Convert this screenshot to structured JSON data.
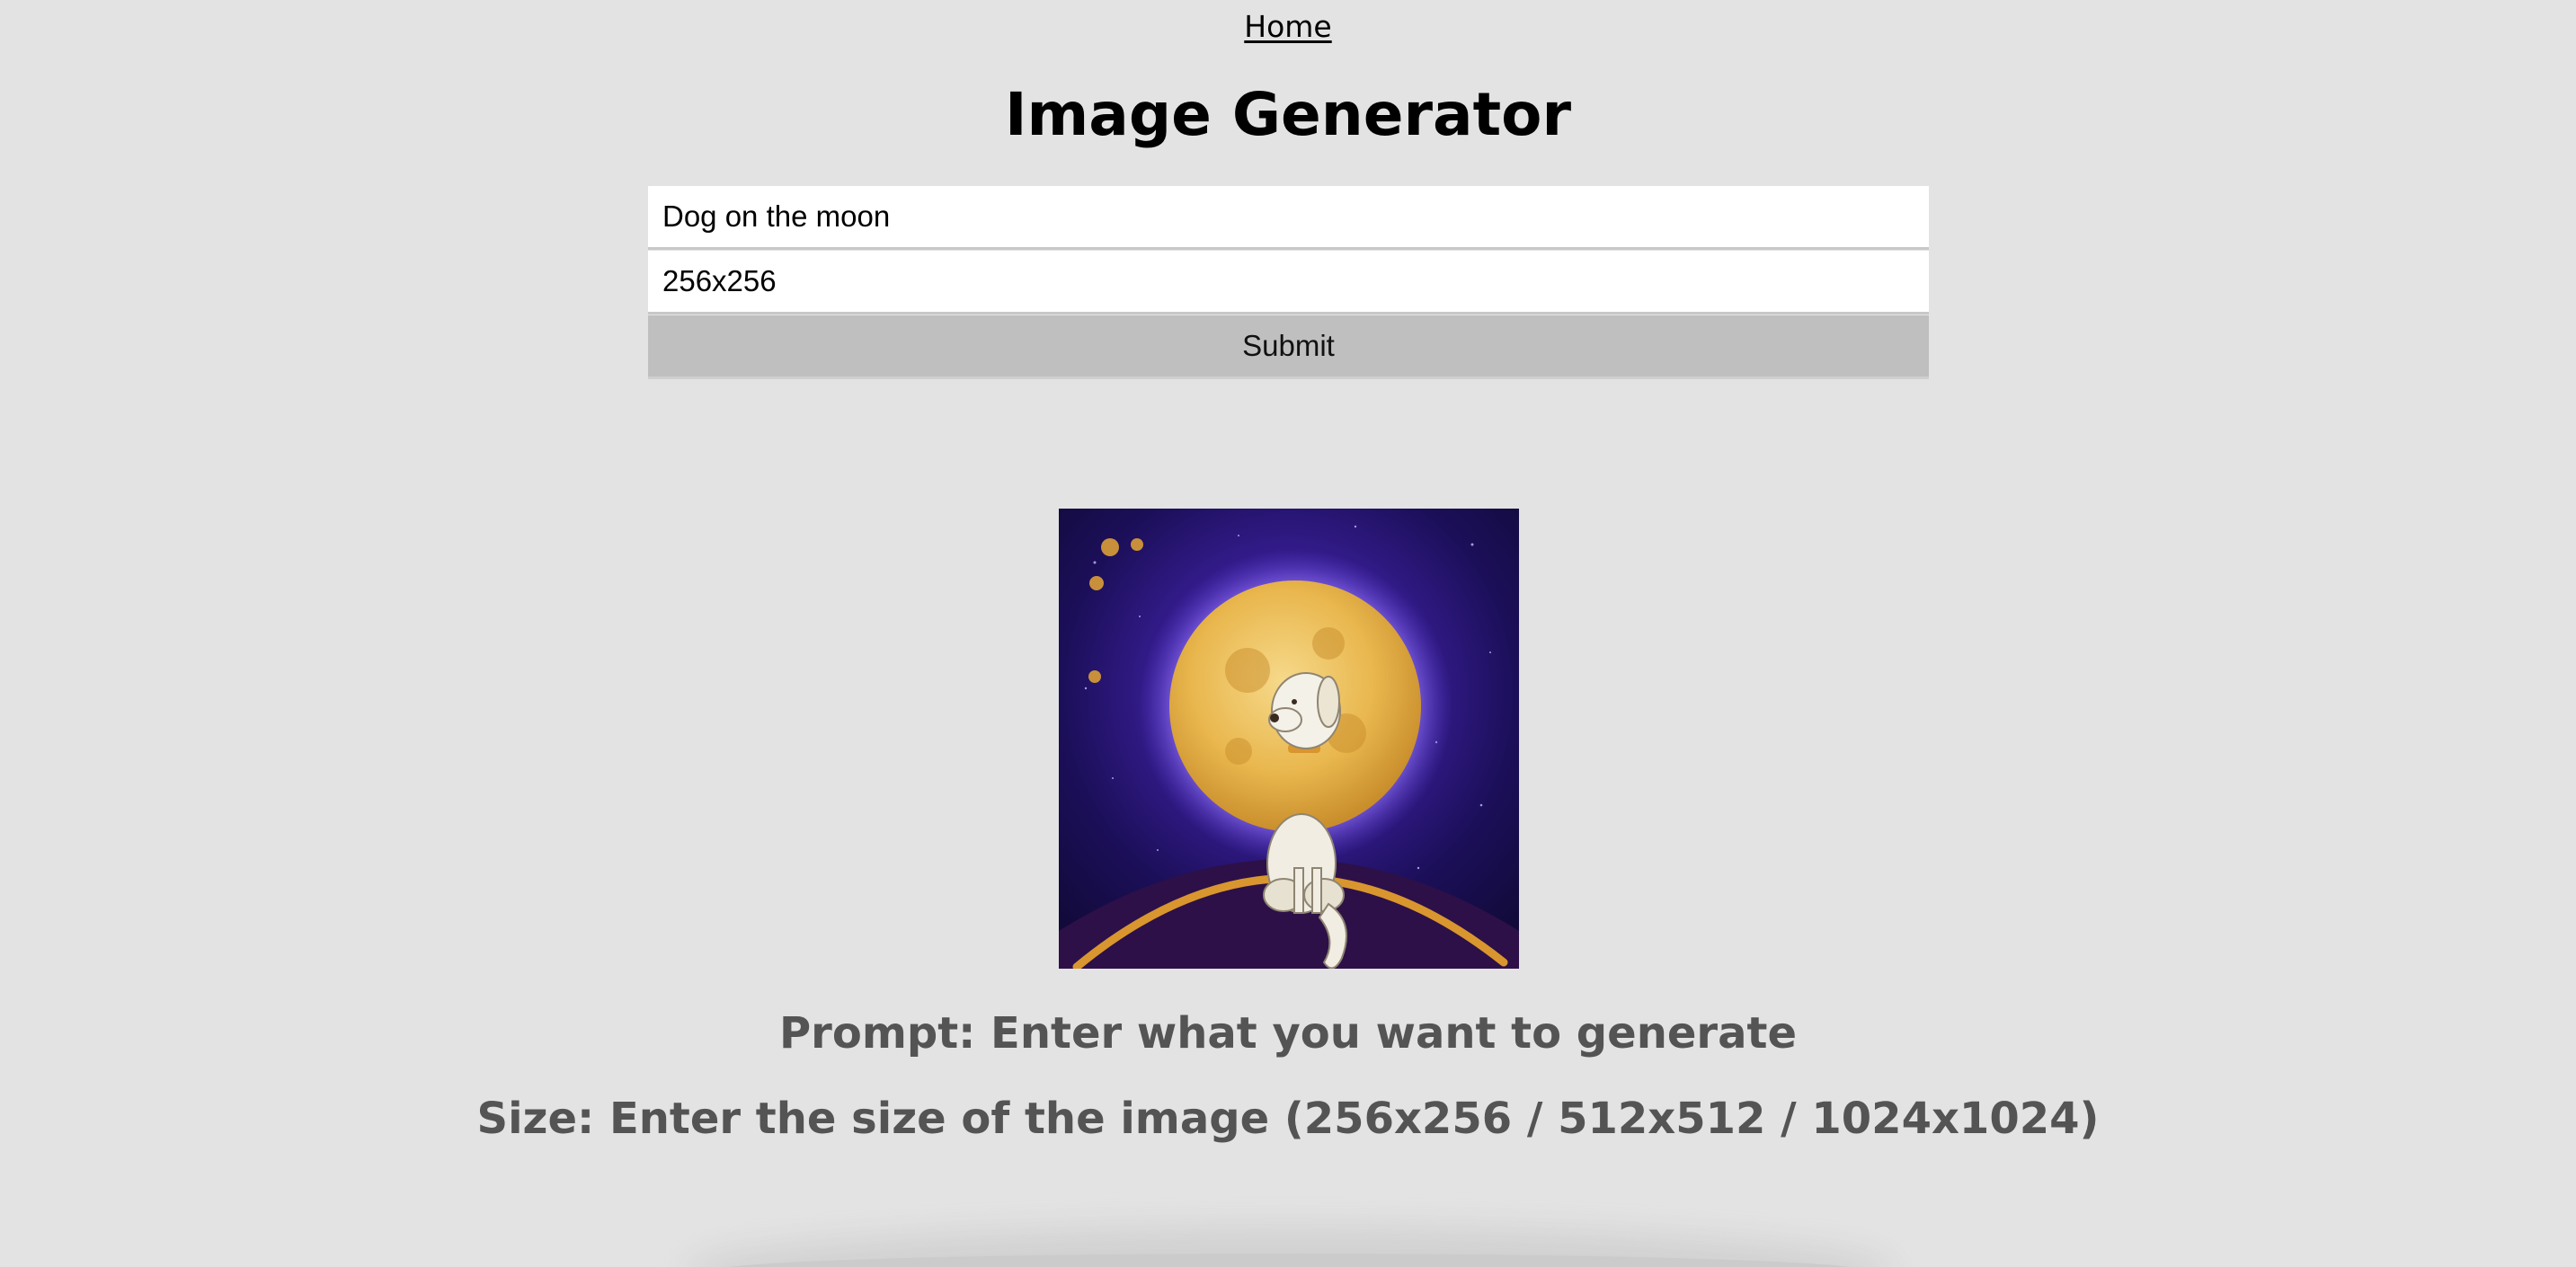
{
  "nav": {
    "home_label": "Home"
  },
  "header": {
    "title": "Image Generator"
  },
  "form": {
    "prompt_value": "Dog on the moon",
    "size_value": "256x256",
    "submit_label": "Submit"
  },
  "result": {
    "image_description_icon": "generated-image"
  },
  "help": {
    "prompt_text": "Prompt: Enter what you want to generate",
    "size_text": "Size: Enter the size of the image (256x256 / 512x512 / 1024x1024)"
  },
  "colors": {
    "background": "#e3e3e3",
    "button": "#bfbfbf",
    "help_text": "#545454"
  }
}
